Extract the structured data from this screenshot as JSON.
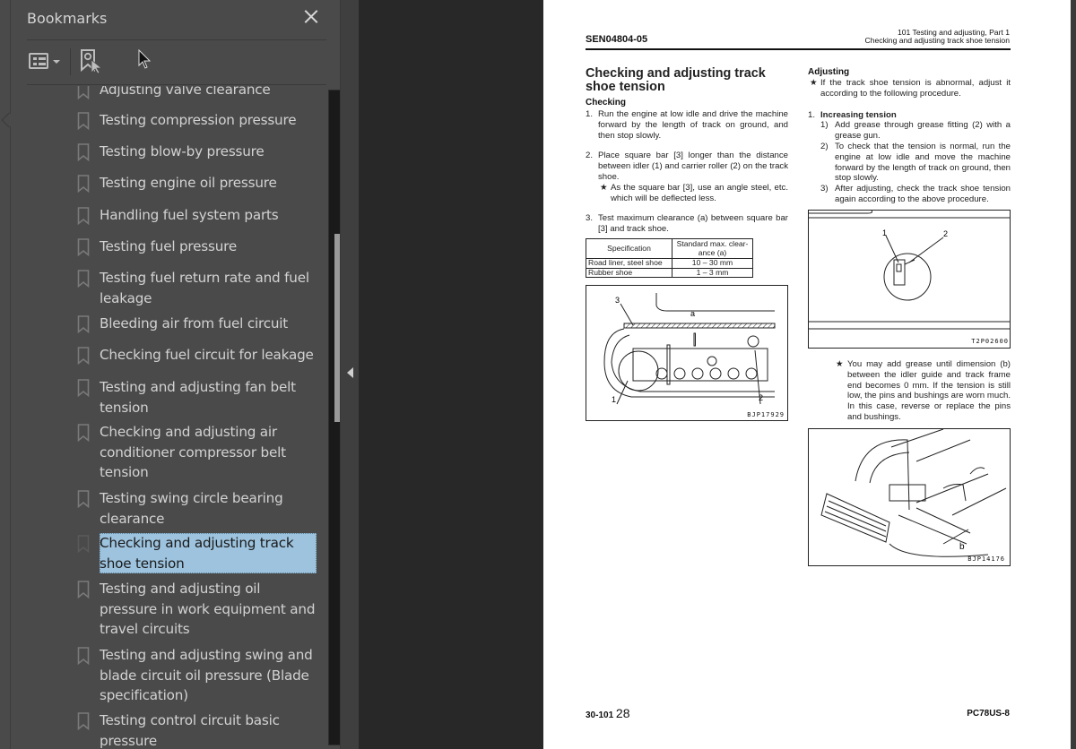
{
  "sidebar": {
    "title": "Bookmarks",
    "close_icon": "close-icon",
    "toolbar": {
      "options_icon": "list-options-icon",
      "find_icon": "find-current-bookmark-icon"
    },
    "items": [
      {
        "label": "Adjusting valve clearance",
        "selected": false
      },
      {
        "label": "Testing compression pressure",
        "selected": false
      },
      {
        "label": "Testing blow-by pressure",
        "selected": false
      },
      {
        "label": "Testing engine oil pressure",
        "selected": false
      },
      {
        "label": "Handling fuel system parts",
        "selected": false
      },
      {
        "label": "Testing fuel pressure",
        "selected": false
      },
      {
        "label": "Testing fuel return rate and fuel leakage",
        "selected": false
      },
      {
        "label": "Bleeding air from fuel circuit",
        "selected": false
      },
      {
        "label": "Checking fuel circuit for leakage",
        "selected": false
      },
      {
        "label": "Testing and adjusting fan belt tension",
        "selected": false
      },
      {
        "label": "Checking and adjusting air conditioner compressor belt tension",
        "selected": false
      },
      {
        "label": "Testing swing circle bearing clearance",
        "selected": false
      },
      {
        "label": "Checking and adjusting track shoe tension",
        "selected": true
      },
      {
        "label": "Testing and adjusting oil pressure in work equipment and travel circuits",
        "selected": false
      },
      {
        "label": "Testing and adjusting swing and blade circuit oil pressure (Blade specification)",
        "selected": false
      },
      {
        "label": "Testing control circuit basic pressure",
        "selected": false
      }
    ]
  },
  "page": {
    "doc_number": "SEN04804-05",
    "header_right_line1": "101 Testing and adjusting, Part 1",
    "header_right_line2": "Checking and adjusting track shoe tension",
    "title": "Checking and adjusting track shoe tension",
    "checking": {
      "heading": "Checking",
      "step1_num": "1.",
      "step1": "Run the engine at low idle and drive the machine forward by the length of track on ground, and then stop slowly.",
      "step2_num": "2.",
      "step2": "Place square bar [3] longer than the distance between idler (1) and carrier roller (2) on the track shoe.",
      "step2_note": "As the square bar [3], use an angle steel, etc. which will be deflected less.",
      "step3_num": "3.",
      "step3": "Test maximum clearance (a) between square bar [3] and track shoe."
    },
    "spec_table": {
      "headers": [
        "Specification",
        "Standard max. clear-ance (a)"
      ],
      "rows": [
        [
          "Road liner, steel shoe",
          "10 – 30 mm"
        ],
        [
          "Rubber shoe",
          "1 – 3 mm"
        ]
      ]
    },
    "figure1": {
      "code": "BJP17929",
      "labels": [
        "3",
        "a",
        "1",
        "2"
      ]
    },
    "adjusting": {
      "heading": "Adjusting",
      "note": "If the track shoe tension is abnormal, adjust it according to the following procedure.",
      "sub_num": "1.",
      "sub_heading": "Increasing tension",
      "steps": [
        {
          "num": "1)",
          "text": "Add grease through grease fitting (2) with a grease gun."
        },
        {
          "num": "2)",
          "text": "To check that the tension is normal, run the engine at low idle and move the machine forward by the length of track on ground, then stop slowly."
        },
        {
          "num": "3)",
          "text": "After adjusting, check the track shoe tension again according to the above procedure."
        }
      ],
      "note2": "You may add grease until dimension (b) between the idler guide and track frame end becomes 0 mm. If the tension is still low, the pins and bushings are worn much. In this case, reverse or replace the pins and bushings."
    },
    "figure2": {
      "code": "T2P02600",
      "labels": [
        "1",
        "2"
      ]
    },
    "figure3": {
      "code": "BJP14176",
      "labels": [
        "b"
      ]
    },
    "star": "★",
    "footer_section": "30-101",
    "footer_page": "28",
    "footer_model": "PC78US-8"
  }
}
